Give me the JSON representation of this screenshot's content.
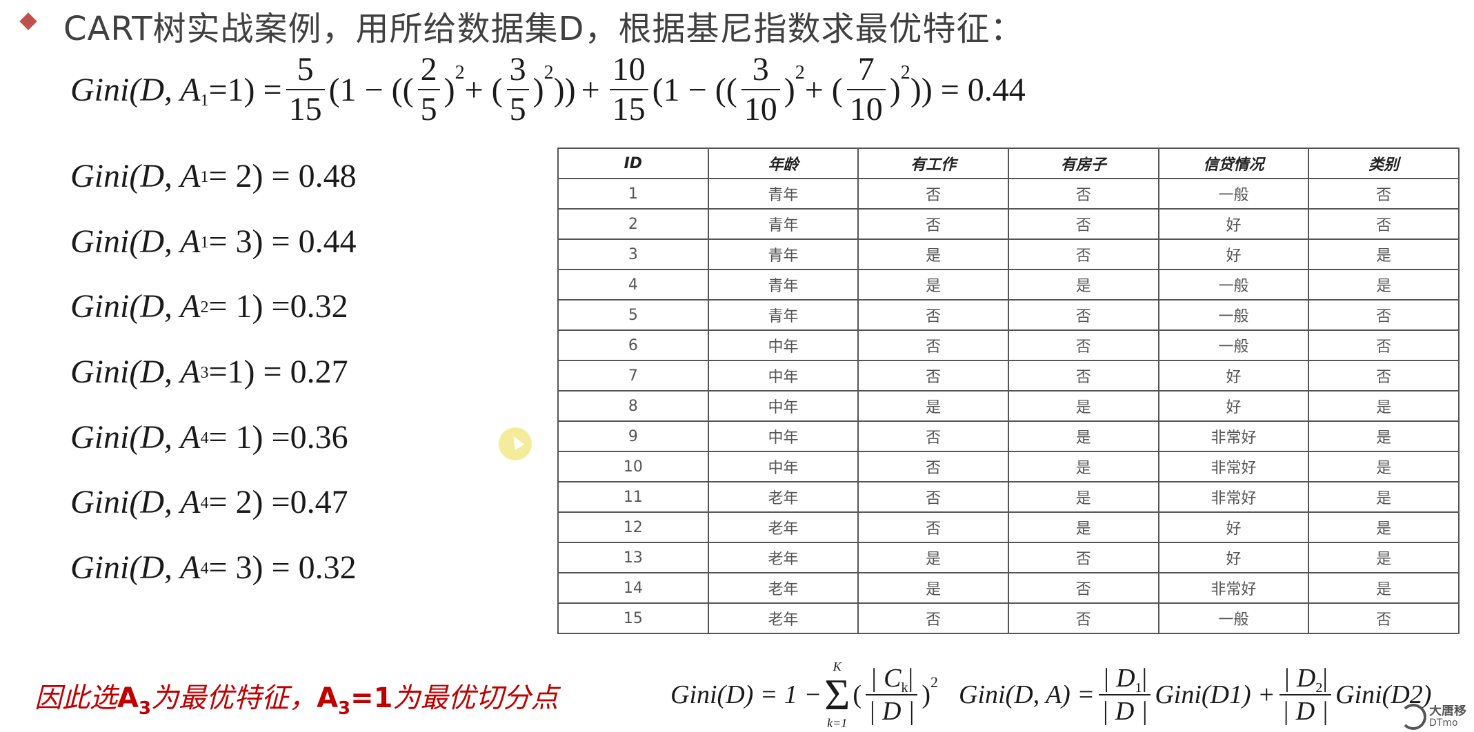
{
  "title": "CART树实战案例，用所给数据集D，根据基尼指数求最优特征：",
  "gini_main": {
    "lhs": "Gini(D, A",
    "lhs_sub": "1",
    "lhs_end": "=1) =",
    "f1_num": "5",
    "f1_den": "15",
    "p1": "(1 − ((",
    "f2_num": "2",
    "f2_den": "5",
    "sq": "2",
    "plus": "+ (",
    "f3_num": "3",
    "f3_den": "5",
    "close1": "))",
    "plus2": "+",
    "f4_num": "10",
    "f4_den": "15",
    "p2": "(1 − ((",
    "f5_num": "3",
    "f5_den": "10",
    "f6_num": "7",
    "f6_den": "10",
    "result": ")) = 0.44"
  },
  "gini_list": [
    {
      "sub": "1",
      "rest": " = 2) = 0.48"
    },
    {
      "sub": "1",
      "rest": " = 3) = 0.44"
    },
    {
      "sub": "2",
      "rest": " = 1) =0.32"
    },
    {
      "sub": "3",
      "rest": " =1) = 0.27"
    },
    {
      "sub": "4",
      "rest": " = 1) =0.36"
    },
    {
      "sub": "4",
      "rest": " = 2) =0.47"
    },
    {
      "sub": "4",
      "rest": " = 3) = 0.32"
    }
  ],
  "gini_prefix": "Gini(D, A",
  "table": {
    "headers": [
      "ID",
      "年龄",
      "有工作",
      "有房子",
      "信贷情况",
      "类别"
    ],
    "rows": [
      [
        "1",
        "青年",
        "否",
        "否",
        "一般",
        "否"
      ],
      [
        "2",
        "青年",
        "否",
        "否",
        "好",
        "否"
      ],
      [
        "3",
        "青年",
        "是",
        "否",
        "好",
        "是"
      ],
      [
        "4",
        "青年",
        "是",
        "是",
        "一般",
        "是"
      ],
      [
        "5",
        "青年",
        "否",
        "否",
        "一般",
        "否"
      ],
      [
        "6",
        "中年",
        "否",
        "否",
        "一般",
        "否"
      ],
      [
        "7",
        "中年",
        "否",
        "否",
        "好",
        "否"
      ],
      [
        "8",
        "中年",
        "是",
        "是",
        "好",
        "是"
      ],
      [
        "9",
        "中年",
        "否",
        "是",
        "非常好",
        "是"
      ],
      [
        "10",
        "中年",
        "否",
        "是",
        "非常好",
        "是"
      ],
      [
        "11",
        "老年",
        "否",
        "是",
        "非常好",
        "是"
      ],
      [
        "12",
        "老年",
        "否",
        "是",
        "好",
        "是"
      ],
      [
        "13",
        "老年",
        "是",
        "否",
        "好",
        "是"
      ],
      [
        "14",
        "老年",
        "是",
        "否",
        "非常好",
        "是"
      ],
      [
        "15",
        "老年",
        "否",
        "否",
        "一般",
        "否"
      ]
    ]
  },
  "conclusion": {
    "p1": "因此选",
    "a": "A",
    "s": "3",
    "p2": "为最优特征，",
    "a2": "A",
    "s2": "3",
    "eq": "=1",
    "p3": "为最优切分点"
  },
  "formula_bottom": {
    "gini_d": "Gini(D) = 1 −",
    "sum_top": "K",
    "sum_bot": "k=1",
    "ck_num": "| C",
    "ck_sub": "k",
    "ck_num_end": "|",
    "ck_den": "| D |",
    "sq": "2",
    "gini_da": "Gini(D, A) =",
    "d1_num": "| D",
    "d1_sub": "1",
    "d_num_end": "|",
    "d_den": "| D |",
    "g1": "Gini(D1) +",
    "d2_num": "| D",
    "d2_sub": "2",
    "g2": "Gini(D2)"
  },
  "logo": {
    "l1": "大唐移",
    "l2": "DTmo"
  }
}
